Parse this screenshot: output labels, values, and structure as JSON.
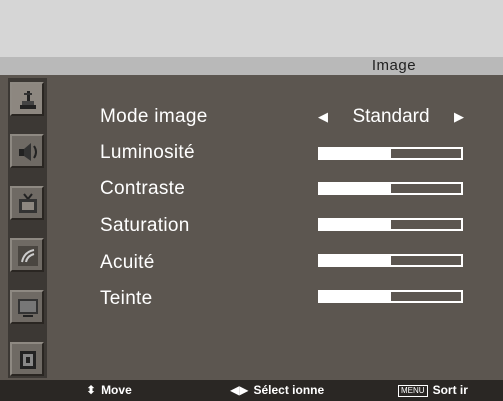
{
  "menu": {
    "title": "Image",
    "sidebar": [
      {
        "icon": "brush-icon",
        "active": true
      },
      {
        "icon": "speaker-icon",
        "active": false
      },
      {
        "icon": "tv-antenna-icon",
        "active": false
      },
      {
        "icon": "signal-icon",
        "active": false
      },
      {
        "icon": "screen-icon",
        "active": false
      },
      {
        "icon": "memory-icon",
        "active": false
      }
    ],
    "rows": [
      {
        "label": "Mode image",
        "value": "Standard",
        "left_arrow": "◀",
        "right_arrow": "▶"
      },
      {
        "label": "Luminosité",
        "level": 0.5
      },
      {
        "label": "Contraste",
        "level": 0.5
      },
      {
        "label": "Saturation",
        "level": 0.5
      },
      {
        "label": "Acuité",
        "level": 0.5
      },
      {
        "label": "Teinte",
        "level": 0.5
      }
    ]
  },
  "footer": {
    "move_glyph": "⬍",
    "move_label": "Move",
    "select_glyph": "◀▶",
    "select_label": "Sélect ionne",
    "menu_key": "MENU",
    "exit_label": "Sort ir"
  },
  "colors": {
    "panel": "#5c5650",
    "title_bar": "#b9b9b9",
    "text": "#ffffff"
  }
}
